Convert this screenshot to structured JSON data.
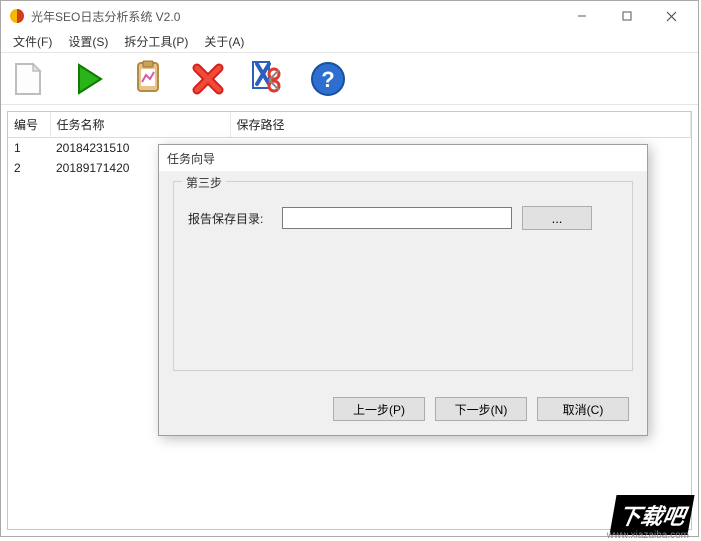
{
  "window": {
    "title": "光年SEO日志分析系统 V2.0"
  },
  "menu": {
    "file": "文件(F)",
    "settings": "设置(S)",
    "split": "拆分工具(P)",
    "about": "关于(A)"
  },
  "toolbar": {
    "new": "新建",
    "run": "运行",
    "report": "报表",
    "delete": "删除",
    "cut": "剪切",
    "help": "帮助"
  },
  "table": {
    "headers": {
      "id": "编号",
      "name": "任务名称",
      "path": "保存路径"
    },
    "rows": [
      {
        "id": "1",
        "name": "20184231510"
      },
      {
        "id": "2",
        "name": "20189171420"
      }
    ]
  },
  "dialog": {
    "title": "任务向导",
    "step_label": "第三步",
    "field_label": "报告保存目录:",
    "field_value": "",
    "browse": "...",
    "prev": "上一步(P)",
    "next": "下一步(N)",
    "cancel": "取消(C)"
  },
  "watermark": {
    "text": "下载吧",
    "url": "www.xiazaiba.com"
  }
}
